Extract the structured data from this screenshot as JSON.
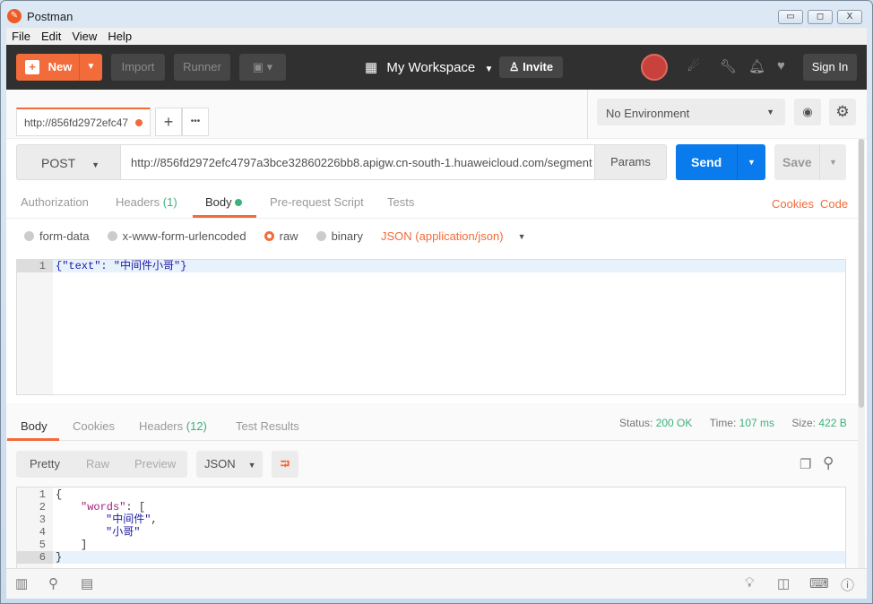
{
  "window": {
    "title": "Postman",
    "minimize": "▭",
    "maximize": "◻",
    "close": "X"
  },
  "menu": [
    "File",
    "Edit",
    "View",
    "Help"
  ],
  "toolbar": {
    "new": "New",
    "import": "Import",
    "runner": "Runner",
    "workspace": "My Workspace",
    "invite": "Invite",
    "sign_in": "Sign In"
  },
  "tabs": {
    "active": "http://856fd2972efc47",
    "add": "+",
    "more": "•••"
  },
  "environment": {
    "selected": "No Environment"
  },
  "request": {
    "method": "POST",
    "url": "http://856fd2972efc4797a3bce32860226bb8.apigw.cn-south-1.huaweicloud.com/segment",
    "params": "Params",
    "send": "Send",
    "save": "Save"
  },
  "req_tabs": {
    "authorization": "Authorization",
    "headers": "Headers",
    "headers_count": "(1)",
    "body": "Body",
    "prerequest": "Pre-request Script",
    "tests": "Tests",
    "cookies": "Cookies",
    "code": "Code"
  },
  "body_modes": {
    "form_data": "form-data",
    "urlencoded": "x-www-form-urlencoded",
    "raw": "raw",
    "binary": "binary",
    "content_type": "JSON (application/json)",
    "selected": "raw"
  },
  "request_body": {
    "lines": [
      {
        "n": "1",
        "text": "{\"text\": \"中间件小哥\"}"
      }
    ]
  },
  "response": {
    "tabs": {
      "body": "Body",
      "cookies": "Cookies",
      "headers": "Headers",
      "headers_count": "(12)",
      "test_results": "Test Results"
    },
    "status_label": "Status:",
    "status": "200 OK",
    "time_label": "Time:",
    "time": "107 ms",
    "size_label": "Size:",
    "size": "422 B",
    "views": {
      "pretty": "Pretty",
      "raw": "Raw",
      "preview": "Preview",
      "format": "JSON"
    },
    "lines": [
      "1",
      "2",
      "3",
      "4",
      "5",
      "6"
    ],
    "body": {
      "l1": "{",
      "key": "\"words\"",
      "l2rest": ": [",
      "w1": "\"中间件\"",
      "comma": ",",
      "w2": "\"小哥\"",
      "l5": "]",
      "l6": "}"
    }
  },
  "colors": {
    "accent": "#f26b3a",
    "send": "#097bed",
    "toolbar": "#303030",
    "success": "#3bb27a"
  }
}
